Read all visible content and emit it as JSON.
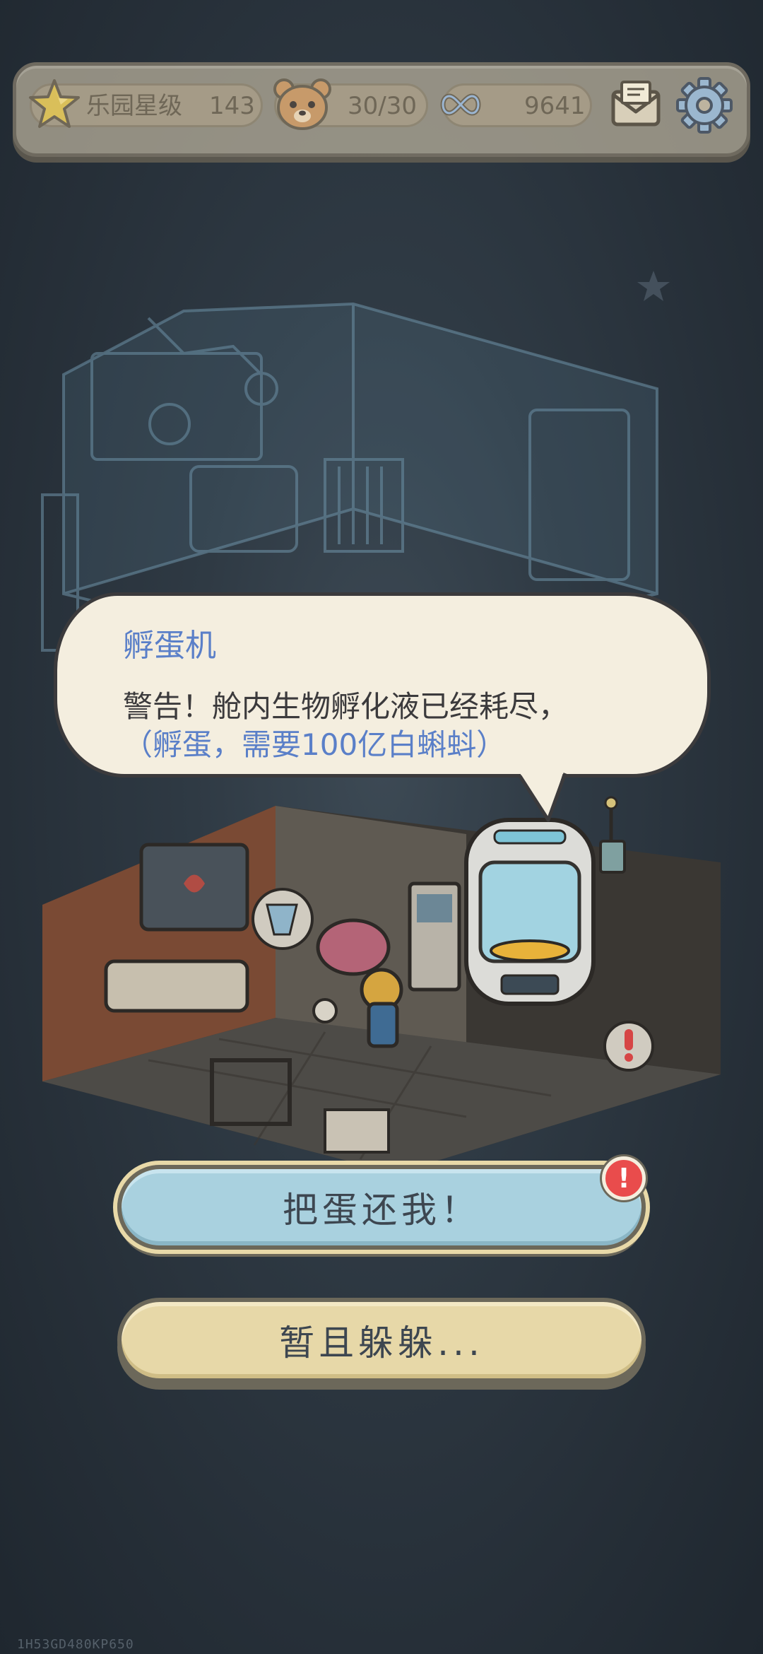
{
  "hud": {
    "park_rating_label": "乐园星级",
    "park_rating_value": "143",
    "bears_value": "30/30",
    "currency_value": "9641",
    "icons": [
      "star-icon",
      "bear-icon",
      "infinity-icon",
      "mail-icon",
      "gear-icon"
    ]
  },
  "dialog": {
    "speaker": "孵蛋机",
    "line1": "警告！舱内生物孵化液已经耗尽，",
    "line2": "（孵蛋，需要100亿白蝌蚪）"
  },
  "buttons": {
    "primary_label": "把蛋还我！",
    "primary_badge": "!",
    "secondary_label": "暂且躲躲..."
  },
  "footer": {
    "device_id": "1H53GD480KP650"
  },
  "colors": {
    "background": "#2f3a44",
    "hud_panel": "#bdb49f",
    "bubble_fill": "#f4eedf",
    "speaker_blue": "#5a7fc8",
    "primary_button": "#a9d1df",
    "secondary_button": "#e7d8a8",
    "alert_red": "#e94c4c"
  }
}
